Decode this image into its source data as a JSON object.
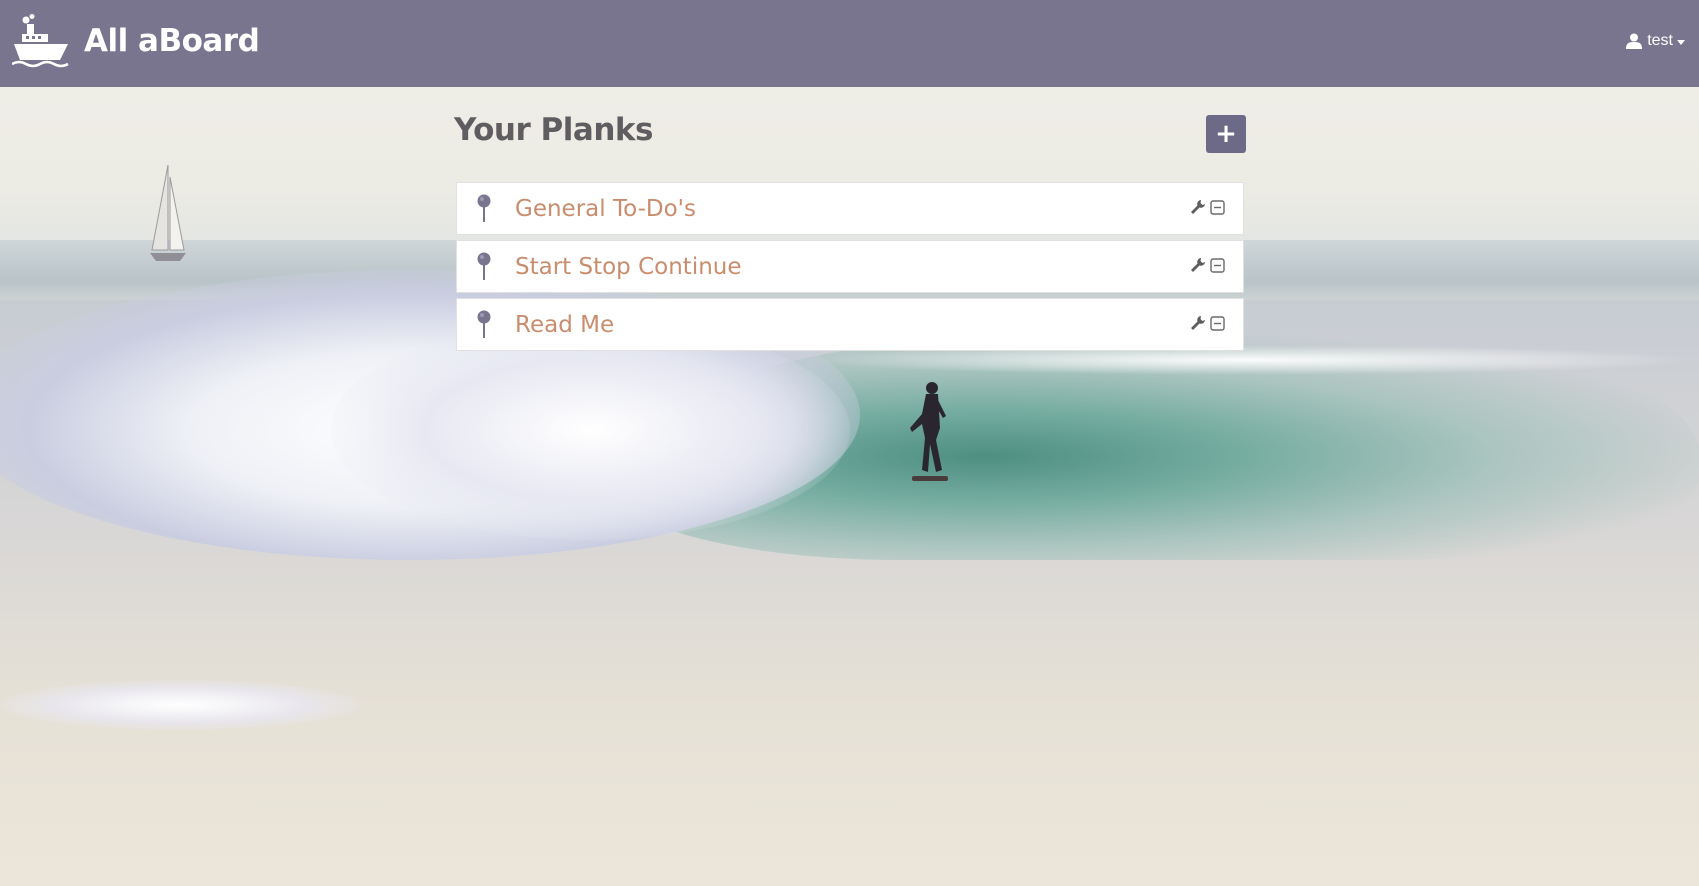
{
  "navbar": {
    "brand_name": "All aBoard",
    "brand_icon": "ship-icon",
    "user_icon": "user-icon",
    "username": "test",
    "background_color": "#79758f"
  },
  "main": {
    "title": "Your Planks",
    "add_button_label": "+",
    "add_button_color": "#6d6a87",
    "planks": [
      {
        "title": "General To-Do's",
        "pin_icon": "pin-icon",
        "edit_icon": "wrench-icon",
        "remove_icon": "minus-square-icon"
      },
      {
        "title": "Start Stop Continue",
        "pin_icon": "pin-icon",
        "edit_icon": "wrench-icon",
        "remove_icon": "minus-square-icon"
      },
      {
        "title": "Read Me",
        "pin_icon": "pin-icon",
        "edit_icon": "wrench-icon",
        "remove_icon": "minus-square-icon"
      }
    ],
    "plank_title_color": "#c98d6e",
    "pin_color": "#79758f"
  }
}
